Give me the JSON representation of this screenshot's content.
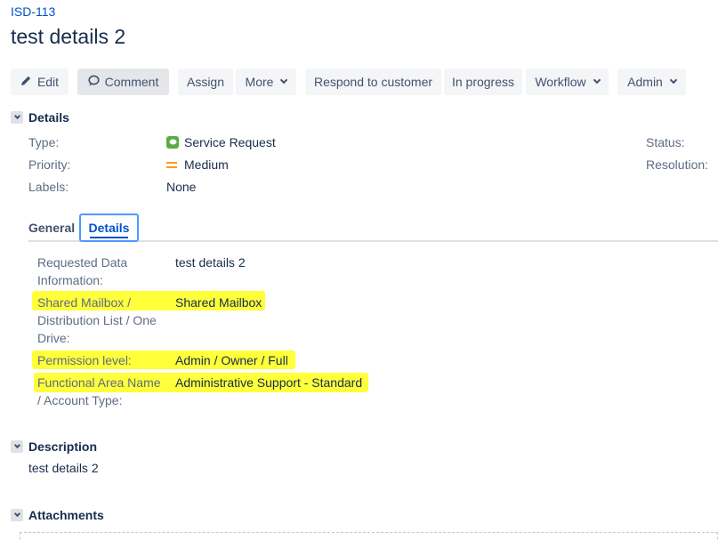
{
  "issue": {
    "key": "ISD-113",
    "summary": "test details 2"
  },
  "toolbar": {
    "edit": "Edit",
    "comment": "Comment",
    "assign": "Assign",
    "more": "More",
    "respond": "Respond to customer",
    "in_progress": "In progress",
    "workflow": "Workflow",
    "admin": "Admin"
  },
  "details": {
    "heading": "Details",
    "type_label": "Type:",
    "type_value": "Service Request",
    "priority_label": "Priority:",
    "priority_value": "Medium",
    "labels_label": "Labels:",
    "labels_value": "None",
    "status_label": "Status:",
    "resolution_label": "Resolution:"
  },
  "tabs": [
    {
      "label": "General"
    },
    {
      "label": "Details"
    }
  ],
  "custom_fields": [
    {
      "label": "Requested Data Information:",
      "value": "test details 2"
    },
    {
      "label": "Shared Mailbox / Distribution List / One Drive:",
      "value": "Shared Mailbox"
    },
    {
      "label": "Permission level:",
      "value": "Admin / Owner / Full"
    },
    {
      "label": "Functional Area Name / Account Type:",
      "value": "Administrative Support - Standard"
    }
  ],
  "description": {
    "heading": "Description",
    "text": "test details 2"
  },
  "attachments": {
    "heading": "Attachments"
  },
  "colors": {
    "link": "#0052cc",
    "highlight": "#ffff3a",
    "service_request_icon": "#5aac44",
    "priority_medium": "#ff991f"
  },
  "icons": {
    "edit": "pencil-icon",
    "comment": "speech-bubble-icon",
    "type": "service-request-icon",
    "priority": "priority-medium-icon"
  }
}
